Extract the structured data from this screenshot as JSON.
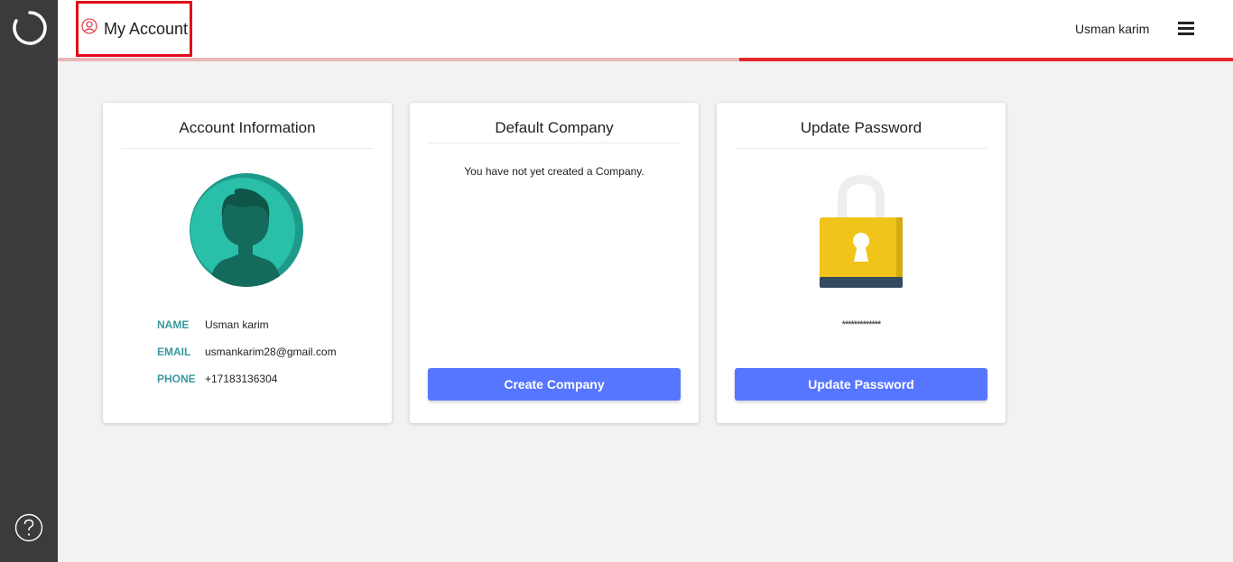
{
  "app": {
    "logo_icon": "loading-spinner-icon",
    "help_icon": "question-circle-icon"
  },
  "header": {
    "title": "My Account",
    "title_icon": "user-circle-icon",
    "user_name": "Usman karim",
    "menu_icon": "hamburger-menu-icon",
    "accent_color": "#e3252b"
  },
  "account_info": {
    "title": "Account Information",
    "avatar_icon": "user-avatar-icon",
    "fields": [
      {
        "label": "NAME",
        "value": "Usman karim"
      },
      {
        "label": "EMAIL",
        "value": "usmankarim28@gmail.com"
      },
      {
        "label": "PHONE",
        "value": "+17183136304"
      }
    ]
  },
  "default_company": {
    "title": "Default Company",
    "message": "You have not yet created a Company.",
    "button_label": "Create Company"
  },
  "update_password": {
    "title": "Update Password",
    "lock_icon": "padlock-icon",
    "masked_password": "*************",
    "button_label": "Update Password"
  }
}
